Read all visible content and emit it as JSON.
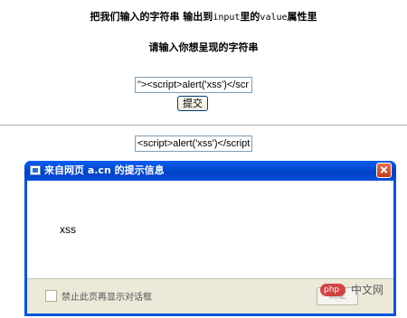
{
  "page": {
    "heading_prefix": "把我们输入的字符串 输出到",
    "heading_input_word": "input",
    "heading_middle": "里的",
    "heading_value_word": "value",
    "heading_suffix": "属性里",
    "prompt": "请输入你想呈现的字符串",
    "input_value": "\"><script>alert('xss')</scr",
    "submit_label": "提交",
    "output_value": "<script>alert('xss')</script"
  },
  "dialog": {
    "title": "来自网页 a.cn 的提示信息",
    "message": "xss",
    "checkbox_label": "禁止此页再显示对话框",
    "ok_label": "确定"
  },
  "watermark": {
    "text": "中文网"
  }
}
